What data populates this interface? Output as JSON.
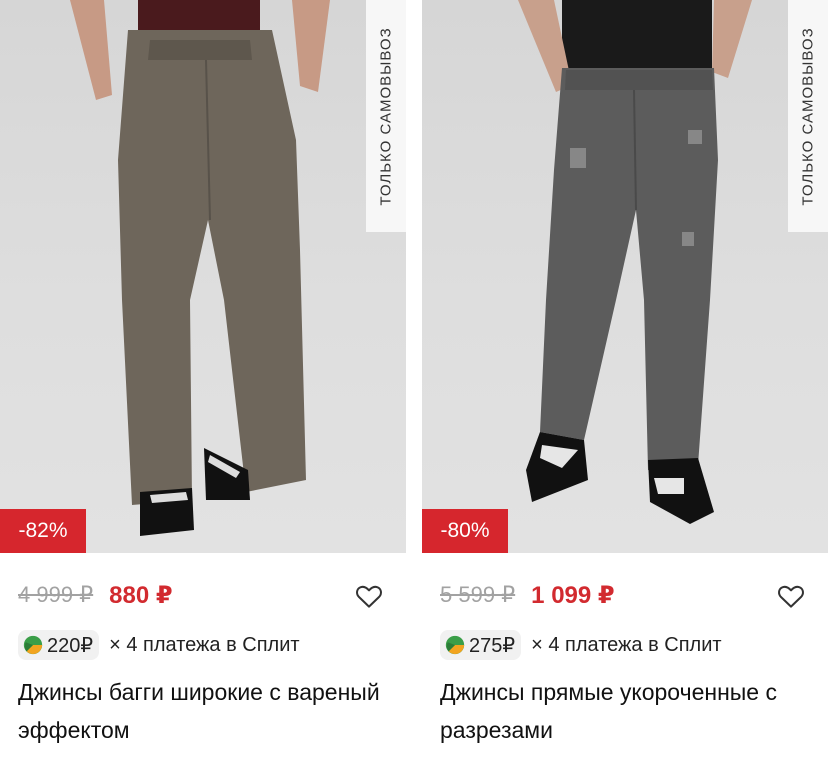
{
  "products": [
    {
      "pickup_only": "ТОЛЬКО САМОВЫВОЗ",
      "discount": "-82%",
      "old_price": "4 999 ₽",
      "new_price": "880 ₽",
      "split_amount": "220₽",
      "split_text": "× 4 платежа в Сплит",
      "title": "Джинсы багги широкие с вареный эффектом",
      "jeans_color": "#6e665b"
    },
    {
      "pickup_only": "ТОЛЬКО САМОВЫВОЗ",
      "discount": "-80%",
      "old_price": "5 599 ₽",
      "new_price": "1 099 ₽",
      "split_amount": "275₽",
      "split_text": "× 4 платежа в Сплит",
      "title": "Джинсы прямые укороченные с разрезами",
      "jeans_color": "#5c5c5c"
    }
  ],
  "colors": {
    "discount_badge": "#d6262d",
    "new_price": "#d22a2f",
    "old_price": "#a2a2a2"
  },
  "icons": {
    "favorite": "heart-outline-icon",
    "split": "split-leaf-icon"
  }
}
